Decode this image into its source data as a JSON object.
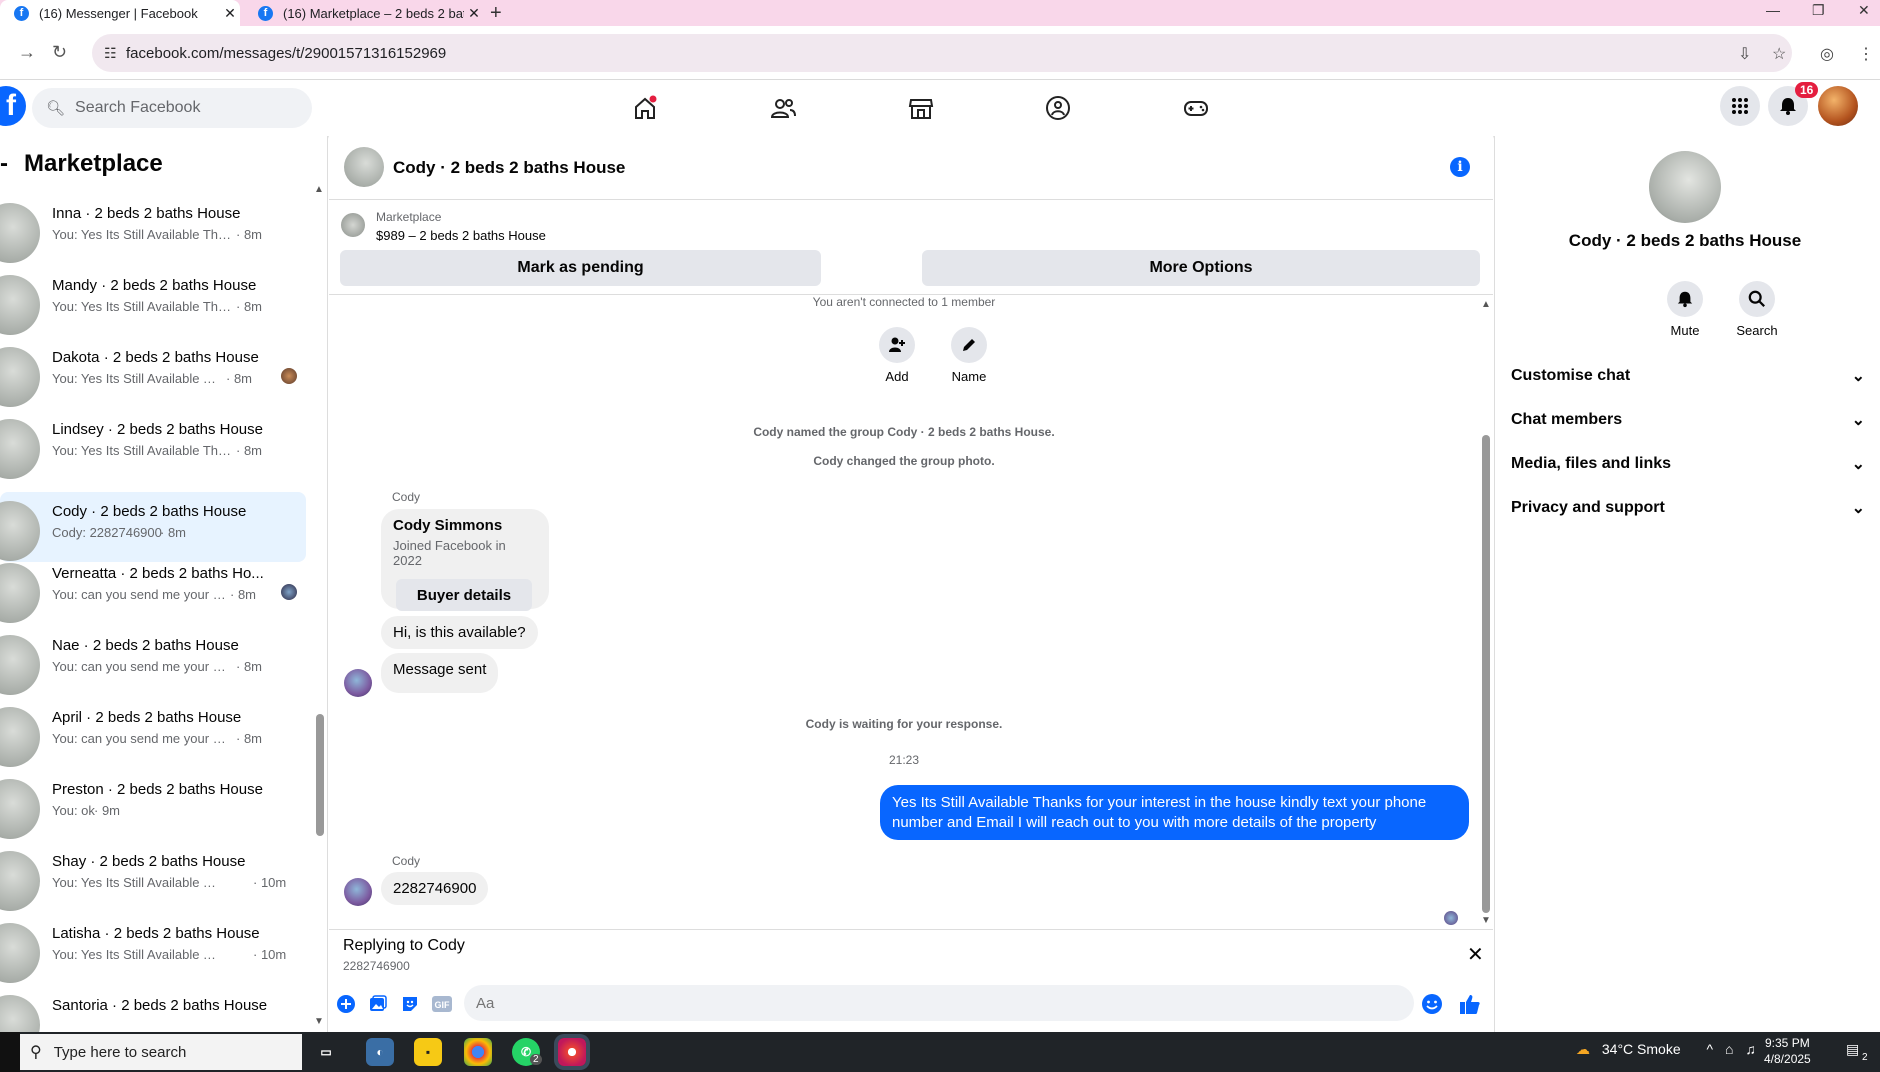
{
  "browser": {
    "tabs": [
      {
        "title": "(16) Messenger | Facebook",
        "active": true
      },
      {
        "title": "(16) Marketplace – 2 beds 2 bat",
        "active": false
      }
    ],
    "url": "facebook.com/messages/t/29001571316152969"
  },
  "fb": {
    "search_placeholder": "Search Facebook",
    "notification_count": "16",
    "nav_icons": [
      "home-icon",
      "friends-icon",
      "marketplace-icon",
      "groups-icon",
      "gaming-icon"
    ]
  },
  "sidebar": {
    "title": "Marketplace",
    "conversations": [
      {
        "name": "Inna · 2 beds 2 baths House",
        "preview": "You: Yes Its Still Available Thanks fo...",
        "time": "· 8m"
      },
      {
        "name": "Mandy · 2 beds 2 baths House",
        "preview": "You: Yes Its Still Available Thanks fo...",
        "time": "· 8m"
      },
      {
        "name": "Dakota · 2 beds 2 baths House",
        "preview": "You: Yes Its Still Available Thank...",
        "time": "· 8m"
      },
      {
        "name": "Lindsey · 2 beds 2 baths House",
        "preview": "You: Yes Its Still Available Thanks fo...",
        "time": "· 8m"
      },
      {
        "name": "Cody · 2 beds 2 baths House",
        "preview": "Cody: 2282746900",
        "time": "· 8m"
      },
      {
        "name": "Verneatta · 2 beds 2 baths Ho...",
        "preview": "You: can you send me your Con...",
        "time": "· 8m"
      },
      {
        "name": "Nae · 2 beds 2 baths House",
        "preview": "You: can you send me your Contac...",
        "time": "· 8m"
      },
      {
        "name": "April · 2 beds 2 baths House",
        "preview": "You: can you send me your Contac...",
        "time": "· 8m"
      },
      {
        "name": "Preston · 2 beds 2 baths House",
        "preview": "You: ok",
        "time": "· 9m"
      },
      {
        "name": "Shay · 2 beds 2 baths House",
        "preview": "You: Yes Its Still Available Thanks f...",
        "time": "· 10m"
      },
      {
        "name": "Latisha · 2 beds 2 baths House",
        "preview": "You: Yes Its Still Available Thanks f...",
        "time": "· 10m"
      },
      {
        "name": "Santoria · 2 beds 2 baths House",
        "preview": "",
        "time": ""
      }
    ]
  },
  "chat": {
    "title": "Cody · 2 beds 2 baths House",
    "marketplace_label": "Marketplace",
    "listing": "$989 – 2 beds 2 baths House",
    "mark_pending": "Mark as pending",
    "more_options": "More Options",
    "not_connected": "You aren't connected to 1 member",
    "add_label": "Add",
    "name_label": "Name",
    "sys_named": "Cody named the group Cody · 2 beds 2 baths House.",
    "sys_photo": "Cody changed the group photo.",
    "sender1": "Cody",
    "card_name": "Cody Simmons",
    "card_joined": "Joined Facebook in 2022",
    "buyer_details": "Buyer details",
    "msg1": "Hi, is this available?",
    "msg2": "Message sent",
    "waiting": "Cody is waiting for your response.",
    "time": "21:23",
    "outgoing": "Yes Its Still Available Thanks for your interest in the house kindly text your phone number and Email I will reach out to you with more details of the property",
    "sender2": "Cody",
    "msg3": "2282746900",
    "replying_to": "Replying to Cody",
    "replying_text": "2282746900",
    "input_placeholder": "Aa"
  },
  "right_panel": {
    "name": "Cody · 2 beds 2 baths House",
    "mute": "Mute",
    "search": "Search",
    "sections": [
      "Customise chat",
      "Chat members",
      "Media, files and links",
      "Privacy and support"
    ]
  },
  "taskbar": {
    "search_placeholder": "Type here to search",
    "whatsapp_badge": "2",
    "weather": "34°C  Smoke",
    "time": "9:35 PM",
    "date": "4/8/2025",
    "notif_count": "2"
  }
}
